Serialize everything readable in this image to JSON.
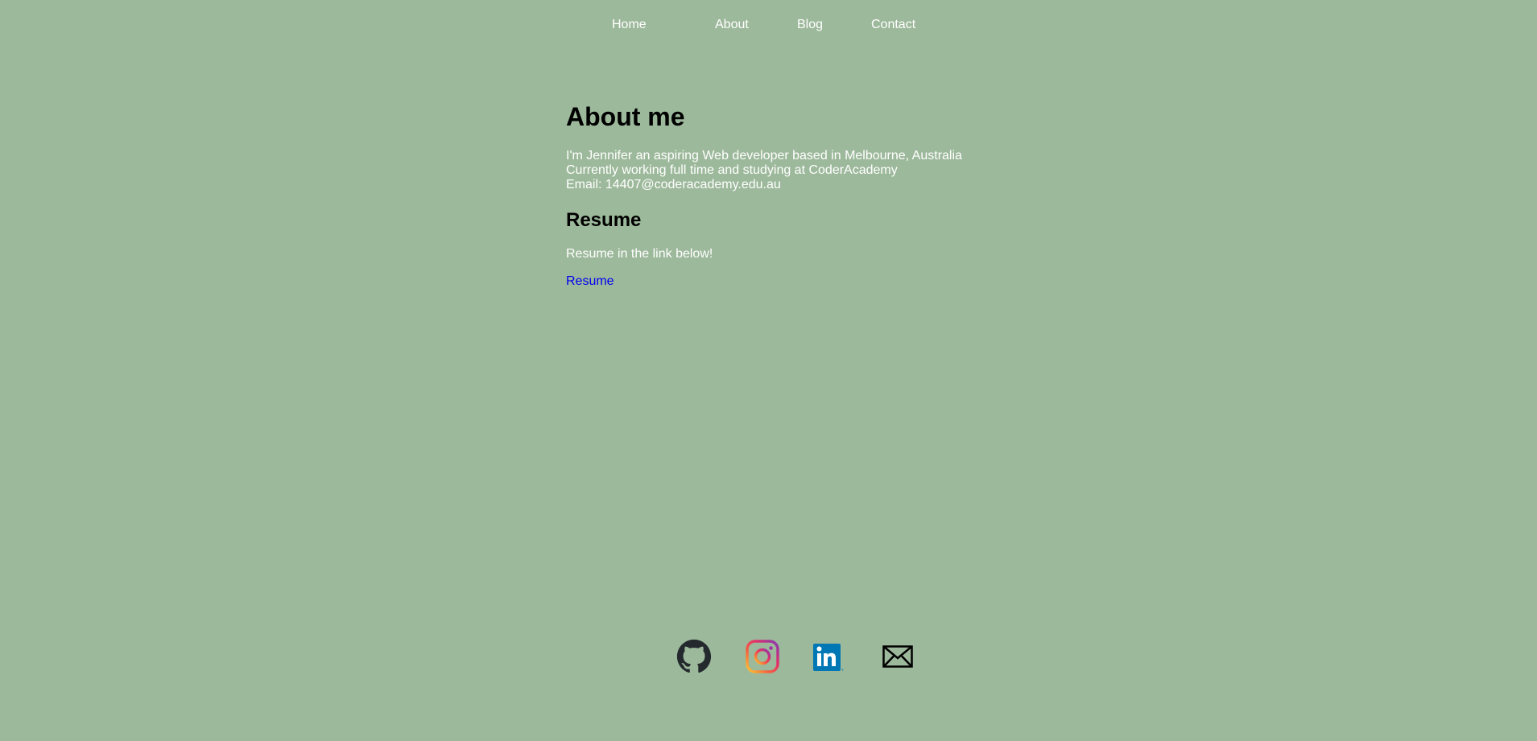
{
  "nav": {
    "items": [
      {
        "label": "Home"
      },
      {
        "label": "About"
      },
      {
        "label": "Blog"
      },
      {
        "label": "Contact"
      }
    ]
  },
  "main": {
    "title": "About me",
    "bio_lines": [
      "I'm Jennifer an aspiring Web developer based in Melbourne, Australia",
      "Currently working full time and studying at CoderAcademy",
      "Email: 14407@coderacademy.edu.au"
    ],
    "resume_heading": "Resume",
    "resume_text": "Resume in the link below!",
    "resume_link": "Resume"
  },
  "footer": {
    "icons": [
      {
        "name": "github-icon",
        "color": "#24292e"
      },
      {
        "name": "instagram-icon",
        "color": "#c13584"
      },
      {
        "name": "linkedin-icon",
        "color": "#0077b5"
      },
      {
        "name": "email-icon",
        "color": "#000000"
      }
    ]
  },
  "colors": {
    "background": "#9db99b",
    "text": "#ffffff",
    "heading": "#000000",
    "link": "#0000ee"
  }
}
